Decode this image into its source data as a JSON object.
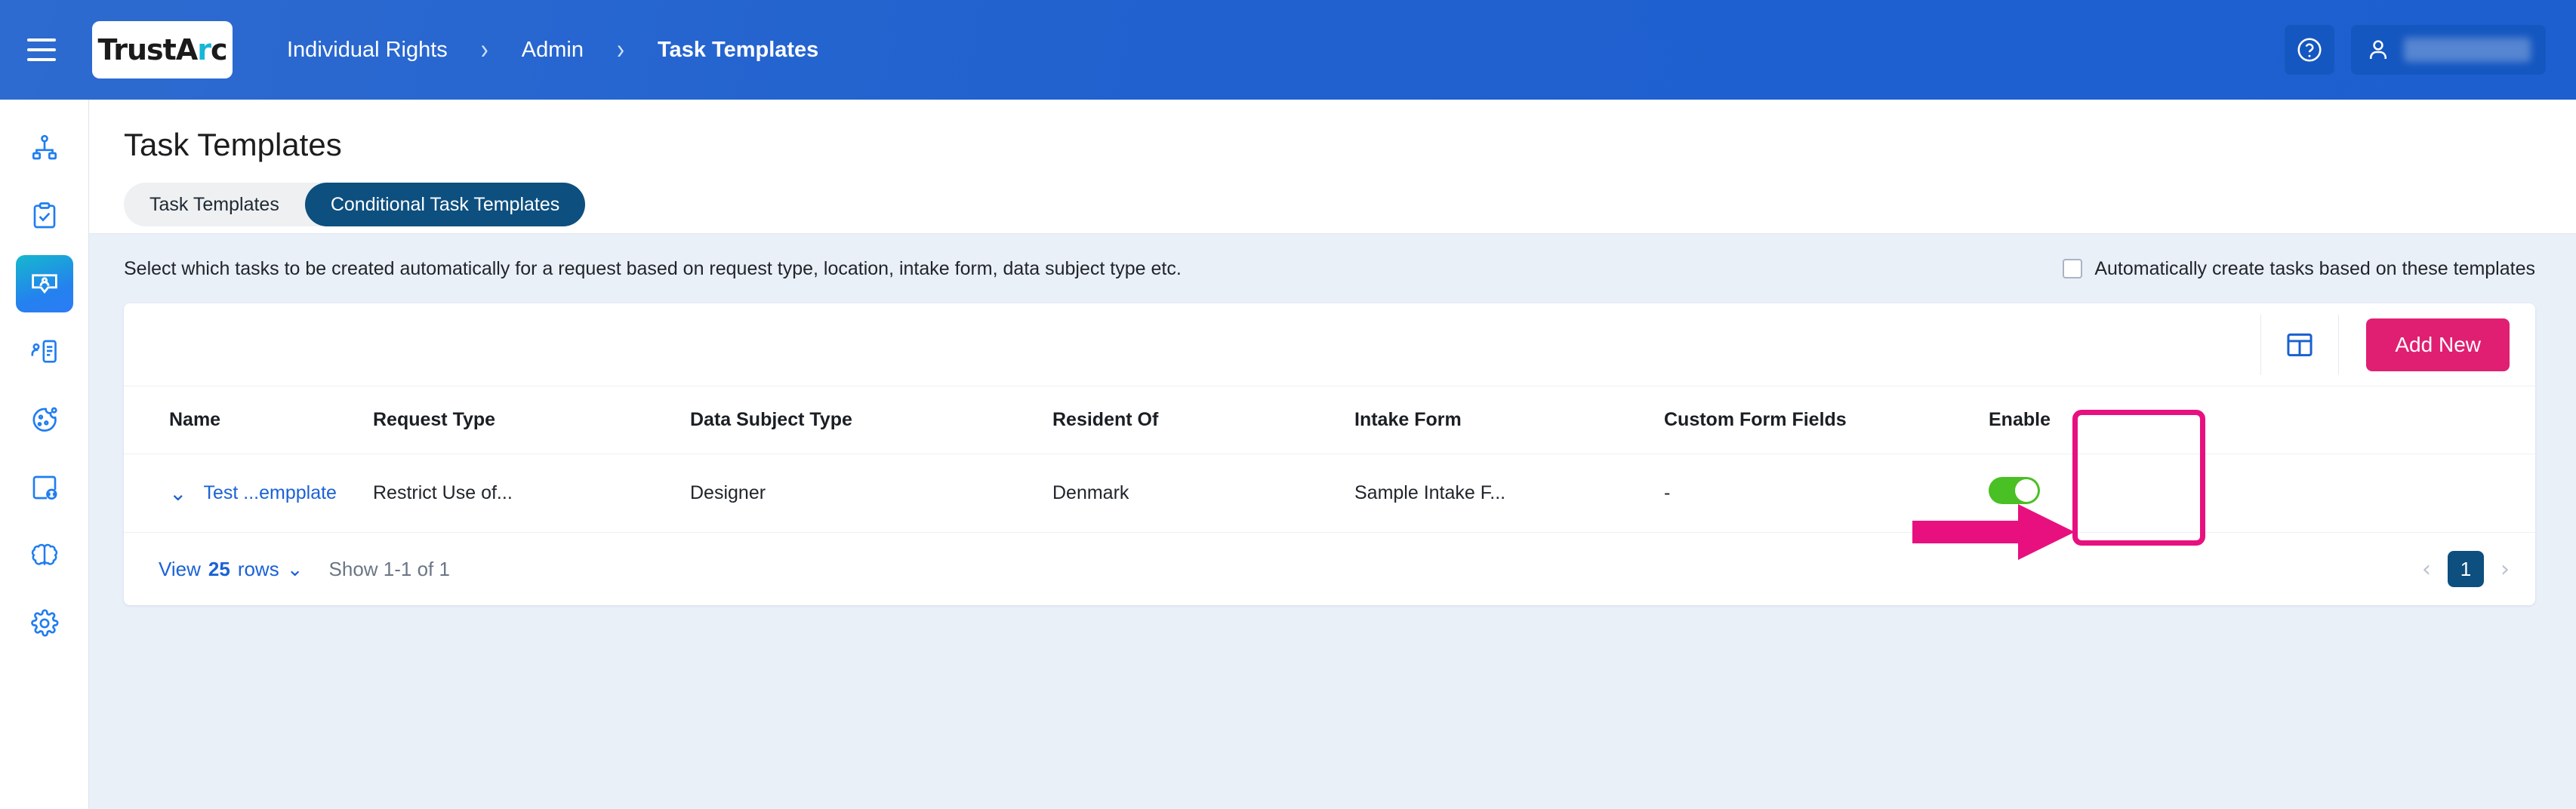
{
  "topbar": {
    "menu_icon": "hamburger-icon",
    "logo": {
      "text_a": "Trust",
      "text_r": "A",
      "text_rc": "r",
      "text_c": "c",
      "full": "TrustArc"
    },
    "breadcrumbs": [
      {
        "label": "Individual Rights",
        "active": false
      },
      {
        "label": "Admin",
        "active": false
      },
      {
        "label": "Task Templates",
        "active": true
      }
    ],
    "separator": "›",
    "help_icon": "question-circle-icon",
    "user_icon": "user-icon",
    "user_name": ""
  },
  "sidebar": {
    "items": [
      {
        "icon": "org-chart-icon",
        "active": false
      },
      {
        "icon": "clipboard-check-icon",
        "active": false
      },
      {
        "icon": "individual-rights-icon",
        "active": true
      },
      {
        "icon": "user-assessment-icon",
        "active": false
      },
      {
        "icon": "cookie-icon",
        "active": false
      },
      {
        "icon": "website-scan-icon",
        "active": false
      },
      {
        "icon": "brain-icon",
        "active": false
      },
      {
        "icon": "gear-icon",
        "active": false
      }
    ]
  },
  "page": {
    "title": "Task Templates",
    "tabs": [
      {
        "label": "Task Templates",
        "active": false
      },
      {
        "label": "Conditional Task Templates",
        "active": true
      }
    ],
    "description": "Select which tasks to be created automatically for a request based on request type, location, intake form, data subject type etc.",
    "auto_create": {
      "label": "Automatically create tasks based on these templates",
      "checked": false
    }
  },
  "toolbar": {
    "columns_icon": "table-columns-icon",
    "add_new_label": "Add New"
  },
  "table": {
    "columns": [
      "Name",
      "Request Type",
      "Data Subject Type",
      "Resident Of",
      "Intake Form",
      "Custom Form Fields",
      "Enable"
    ],
    "rows": [
      {
        "expand_icon": "chevron-down-icon",
        "name": "Test ...empplate",
        "request_type": "Restrict Use of...",
        "data_subject_type": "Designer",
        "resident_of": "Denmark",
        "intake_form": "Sample Intake F...",
        "custom_form_fields": "-",
        "enable": true
      }
    ]
  },
  "footer": {
    "view_prefix": "View ",
    "view_count": "25",
    "view_suffix": " rows",
    "view_chevron": "⌄",
    "showing": "Show 1-1 of 1",
    "prev_icon": "‹",
    "next_icon": "›",
    "current_page": "1"
  },
  "annotations": {
    "highlight_target": "enable-toggle-column",
    "arrow_target": "enable-toggle",
    "color": "#e8107f"
  },
  "colors": {
    "header_blue": "#2061cf",
    "accent_pink": "#e01f72",
    "tab_active": "#0d4f7f",
    "toggle_on": "#49c023",
    "link_blue": "#1a62d6",
    "page_bg": "#eaf0f8"
  }
}
